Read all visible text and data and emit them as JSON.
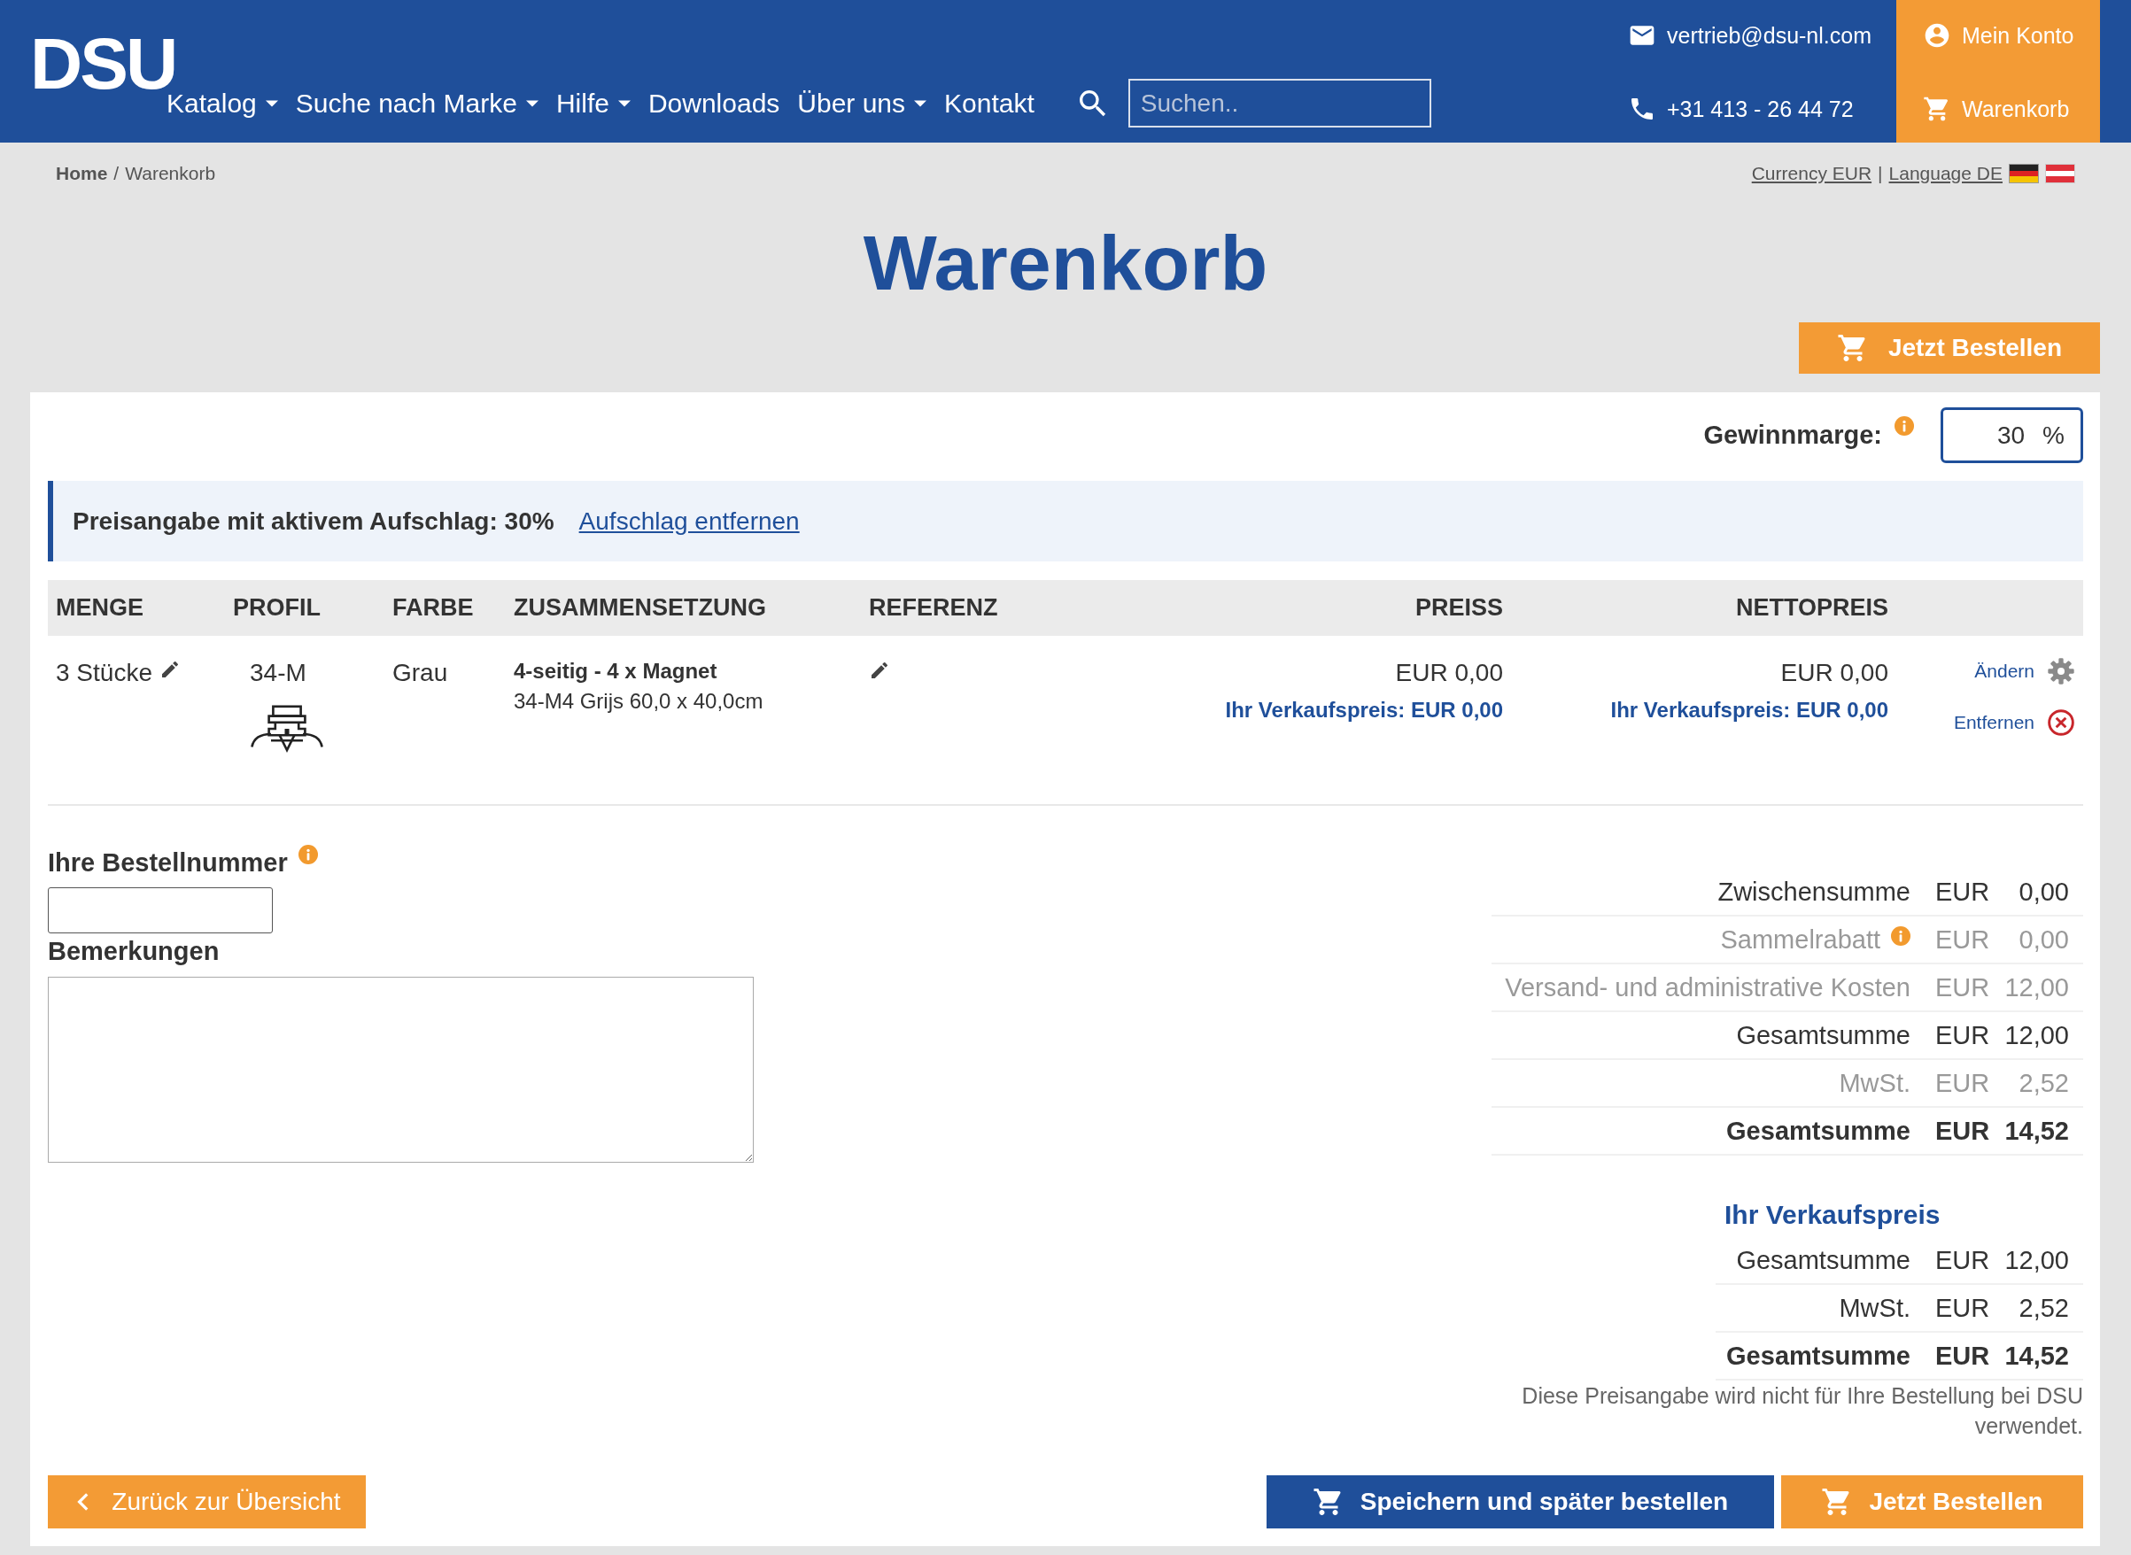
{
  "header": {
    "logo": "DSU",
    "nav": [
      {
        "label": "Katalog",
        "dropdown": true
      },
      {
        "label": "Suche nach Marke",
        "dropdown": true
      },
      {
        "label": "Hilfe",
        "dropdown": true
      },
      {
        "label": "Downloads",
        "dropdown": false
      },
      {
        "label": "Über uns",
        "dropdown": true
      },
      {
        "label": "Kontakt",
        "dropdown": false
      }
    ],
    "search": {
      "placeholder": "Suchen.."
    },
    "email": "vertrieb@dsu-nl.com",
    "phone": "+31 413 - 26 44 72",
    "account": "Mein Konto",
    "cart": "Warenkorb"
  },
  "breadcrumb": {
    "items": [
      {
        "label": "Home",
        "kind": "link"
      },
      {
        "label": "Warenkorb",
        "kind": "current"
      }
    ],
    "separator": "/"
  },
  "settings": {
    "currency": "Currency EUR",
    "separator": "|",
    "language": "Language DE"
  },
  "title": "Warenkorb",
  "order_button": "Jetzt Bestellen",
  "margin": {
    "label": "Gewinnmarge:",
    "value": "30",
    "unit": "%"
  },
  "notice": {
    "text": "Preisangabe mit aktivem Aufschlag: 30%",
    "link": "Aufschlag entfernen"
  },
  "table": {
    "columns": [
      "MENGE",
      "PROFIL",
      "FARBE",
      "ZUSAMMENSETZUNG",
      "REFERENZ",
      "PREISS",
      "NETTOPREIS"
    ],
    "rows": [
      {
        "quantity": "3 Stücke",
        "profile": "34-M",
        "colour": "Grau",
        "composition_title": "4-seitig - 4 x Magnet",
        "composition_detail": "34-M4 Grijs 60,0 x 40,0cm",
        "price": "EUR 0,00",
        "price_sale": "Ihr Verkaufspreis: EUR 0,00",
        "net": "EUR 0,00",
        "net_sale": "Ihr Verkaufspreis: EUR 0,00",
        "edit": "Ändern",
        "remove": "Entfernen"
      }
    ]
  },
  "order_number": {
    "label": "Ihre Bestellnummer"
  },
  "remarks": {
    "label": "Bemerkungen"
  },
  "summary": [
    {
      "label": "Zwischensumme",
      "currency": "EUR",
      "amount": "0,00",
      "kind": "normal",
      "info": false
    },
    {
      "label": "Sammelrabatt",
      "currency": "EUR",
      "amount": "0,00",
      "kind": "muted",
      "info": true
    },
    {
      "label": "Versand- und administrative Kosten",
      "currency": "EUR",
      "amount": "12,00",
      "kind": "muted",
      "info": false
    },
    {
      "label": "Gesamtsumme",
      "currency": "EUR",
      "amount": "12,00",
      "kind": "normal",
      "info": false
    },
    {
      "label": "MwSt.",
      "currency": "EUR",
      "amount": "2,52",
      "kind": "muted",
      "info": false
    },
    {
      "label": "Gesamtsumme",
      "currency": "EUR",
      "amount": "14,52",
      "kind": "total",
      "info": false
    }
  ],
  "sale": {
    "title": "Ihr Verkaufspreis",
    "rows": [
      {
        "label": "Gesamtsumme",
        "currency": "EUR",
        "amount": "12,00",
        "kind": "normal",
        "info": false
      },
      {
        "label": "MwSt.",
        "currency": "EUR",
        "amount": "2,52",
        "kind": "normal",
        "info": false
      },
      {
        "label": "Gesamtsumme",
        "currency": "EUR",
        "amount": "14,52",
        "kind": "total",
        "info": false
      }
    ],
    "note": "Diese Preisangabe wird nicht für Ihre Bestellung bei DSU verwendet."
  },
  "actions": {
    "back": "Zurück zur Übersicht",
    "save": "Speichern und später bestellen",
    "order": "Jetzt Bestellen"
  }
}
